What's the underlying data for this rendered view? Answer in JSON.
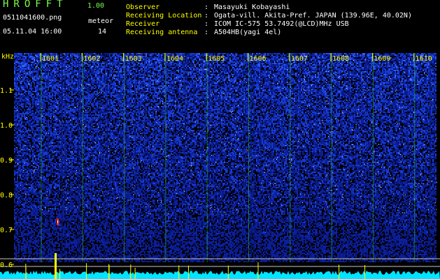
{
  "header": {
    "app_title": "HROFFT",
    "app_version": "1.00",
    "filename": "0511041600.png",
    "datetime": "05.11.04 16:00",
    "meteor_label": "meteor",
    "meteor_count": "14",
    "observer_label": "Observer",
    "observer_value": "Masayuki Kobayashi",
    "location_label": "Receiving Location",
    "location_value": "Ogata-vill. Akita-Pref. JAPAN (139.96E, 40.02N)",
    "receiver_label": "Receiver",
    "receiver_value": "ICOM IC-575 53.7492(@LCD)MHz USB",
    "antenna_label": "Receiving antenna",
    "antenna_value": "A504HB(yagi 4el)"
  },
  "chart_data": {
    "type": "heatmap",
    "ylabel": "kHz",
    "y_ticks": [
      "1.1",
      "1.0",
      "0.9",
      "0.8",
      "0.7",
      "0.6"
    ],
    "x_ticks": [
      "1601",
      "1602",
      "1603",
      "1604",
      "1605",
      "1606",
      "1607",
      "1608",
      "1609",
      "1610"
    ],
    "meteor_echo": {
      "minute": "1601",
      "khz": 0.72
    },
    "colors": {
      "background": "#000000",
      "noise_low": "#0a1a8c",
      "noise_high": "#3a6bff",
      "speckle": "#ffffff",
      "grid": "#c8c8c8",
      "minute_line": "#2fbf2f",
      "label": "#ffff00",
      "baseline": "#00e5ff",
      "echo": "#ff2020"
    }
  }
}
